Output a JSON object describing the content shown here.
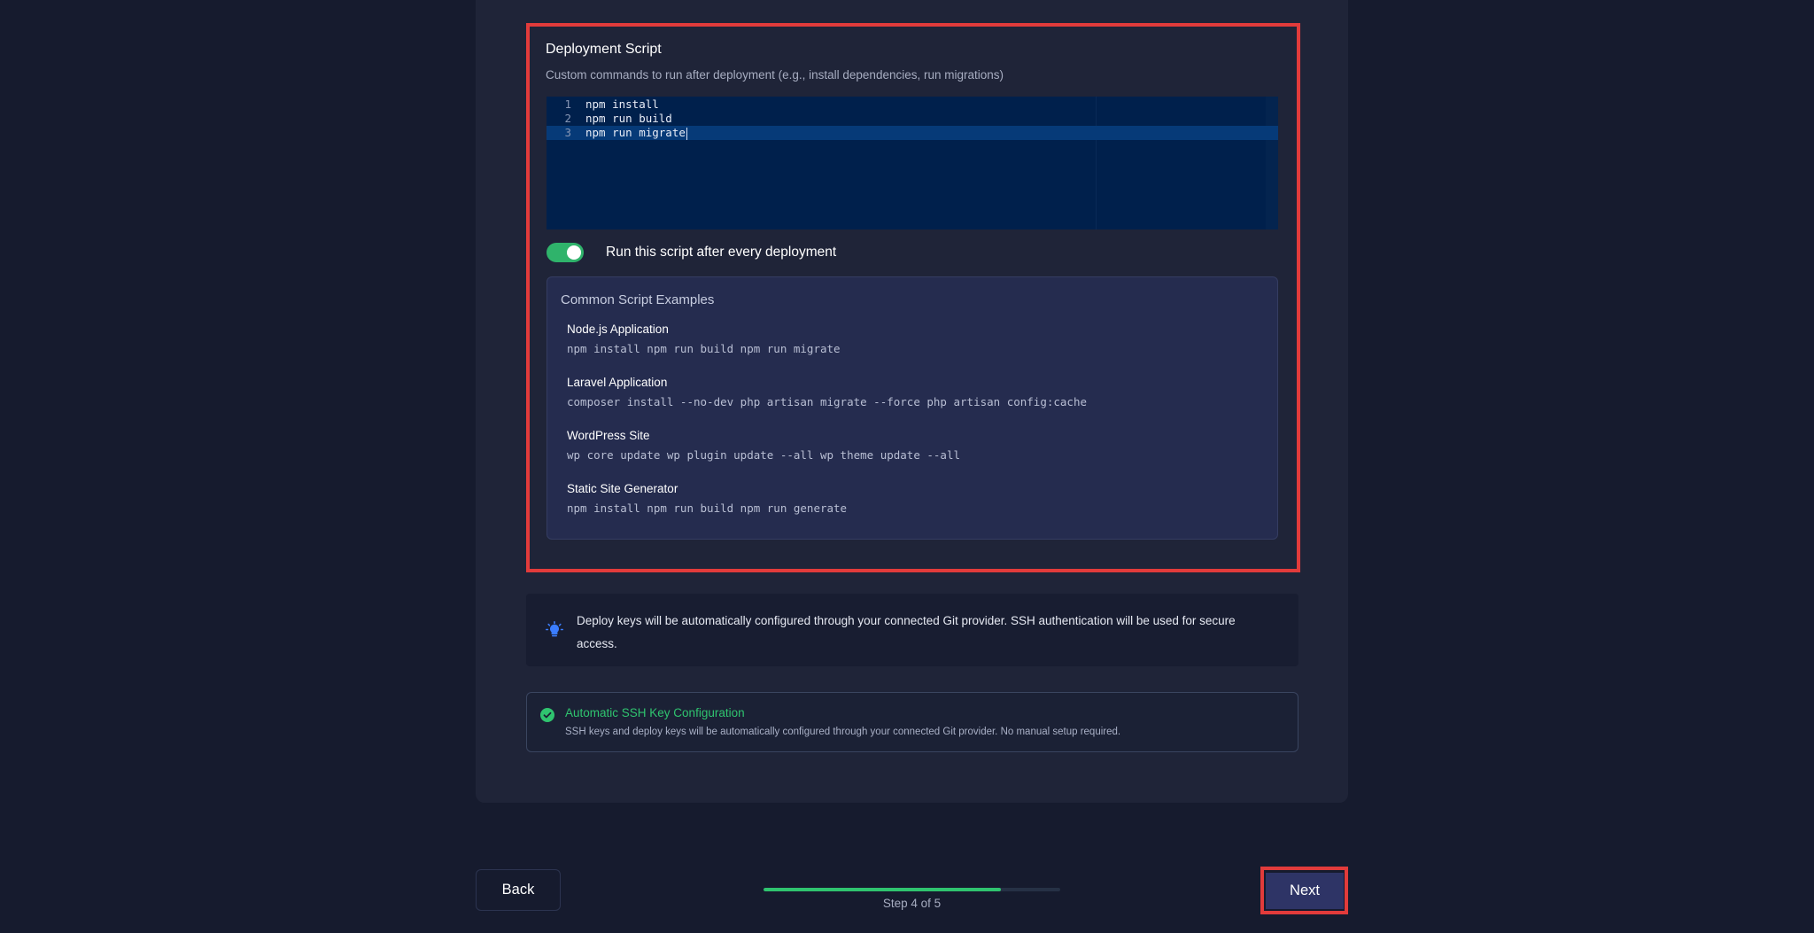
{
  "deployment_script": {
    "title": "Deployment Script",
    "description": "Custom commands to run after deployment (e.g., install dependencies, run migrations)",
    "lines": [
      {
        "number": "1",
        "text": "npm install"
      },
      {
        "number": "2",
        "text": "npm run build"
      },
      {
        "number": "3",
        "text": "npm run migrate"
      }
    ],
    "active_line": 3
  },
  "toggle": {
    "label": "Run this script after every deployment",
    "enabled": true,
    "color": "#2fb36b"
  },
  "examples": {
    "title": "Common Script Examples",
    "items": [
      {
        "name": "Node.js Application",
        "code": "npm install npm run build npm run migrate"
      },
      {
        "name": "Laravel Application",
        "code": "composer install --no-dev php artisan migrate --force php artisan config:cache"
      },
      {
        "name": "WordPress Site",
        "code": "wp core update wp plugin update --all wp theme update --all"
      },
      {
        "name": "Static Site Generator",
        "code": "npm install npm run build npm run generate"
      }
    ]
  },
  "info": {
    "icon": "lightbulb-icon",
    "text": "Deploy keys will be automatically configured through your connected Git provider. SSH authentication will be used for secure access."
  },
  "ssh": {
    "icon": "check-circle-icon",
    "title": "Automatic SSH Key Configuration",
    "description": "SSH keys and deploy keys will be automatically configured through your connected Git provider. No manual setup required."
  },
  "footer": {
    "back_label": "Back",
    "next_label": "Next",
    "step_text": "Step 4 of 5",
    "progress": 0.8
  },
  "colors": {
    "accent_green": "#2fc46f",
    "highlight_red": "#e23b3b",
    "editor_bg": "#00204c"
  }
}
